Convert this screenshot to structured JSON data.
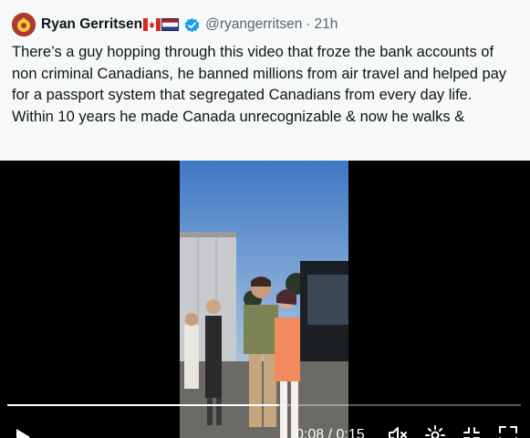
{
  "tweet": {
    "author_name": "Ryan Gerritsen",
    "flags": [
      "canada-flag-icon",
      "netherlands-flag-icon"
    ],
    "verified_icon": "verified-badge-icon",
    "handle": "@ryangerritsen",
    "separator": "·",
    "time": "21h",
    "text_lines": [
      "There’s a guy hopping through this video  that froze the bank accounts of non criminal Canadians, he banned millions from air travel and helped pay for a passport system that segregated Canadians from every day life.",
      "Within 10 years he made Canada unrecognizable & now he walks &"
    ]
  },
  "video": {
    "current_time": "0:08",
    "time_separator": "/",
    "duration": "0:15",
    "time_display": "0:08 / 0:15",
    "progress_fraction": 0.53,
    "controls": [
      "play-icon",
      "volume-icon",
      "settings-icon",
      "fullscreen-exit-icon",
      "fullscreen-icon"
    ]
  },
  "colors": {
    "background": "#f7f9f9",
    "text": "#0f1419",
    "secondary_text": "#536471",
    "verified": "#1d9bf0",
    "video_background": "#000000"
  }
}
